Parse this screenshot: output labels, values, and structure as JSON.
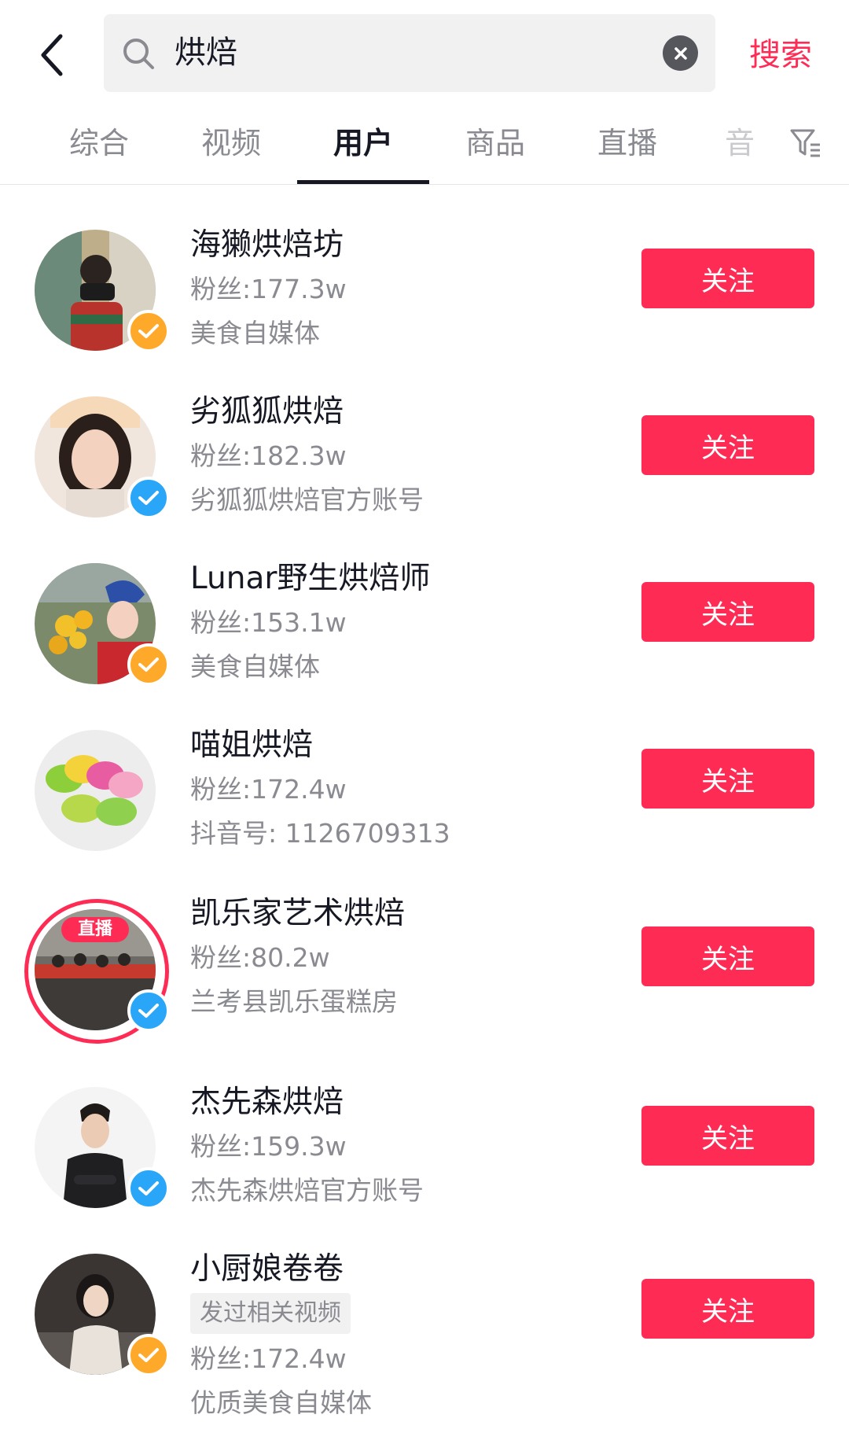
{
  "search": {
    "query": "烘焙",
    "submit_label": "搜索"
  },
  "tabs": [
    {
      "label": "综合",
      "active": false
    },
    {
      "label": "视频",
      "active": false
    },
    {
      "label": "用户",
      "active": true
    },
    {
      "label": "商品",
      "active": false
    },
    {
      "label": "直播",
      "active": false
    },
    {
      "label": "音",
      "active": false
    }
  ],
  "users": [
    {
      "name": "海獭烘焙坊",
      "fans": "粉丝:177.3w",
      "desc": "美食自媒体",
      "verified": "orange",
      "follow": "关注"
    },
    {
      "name": "劣狐狐烘焙",
      "fans": "粉丝:182.3w",
      "desc": "劣狐狐烘焙官方账号",
      "verified": "blue",
      "follow": "关注"
    },
    {
      "name": "Lunar野生烘焙师",
      "fans": "粉丝:153.1w",
      "desc": "美食自媒体",
      "verified": "orange",
      "follow": "关注"
    },
    {
      "name": "喵姐烘焙",
      "fans": "粉丝:172.4w",
      "desc": "抖音号: 1126709313",
      "verified": "none",
      "follow": "关注"
    },
    {
      "name": "凯乐家艺术烘焙",
      "fans": "粉丝:80.2w",
      "desc": "兰考县凯乐蛋糕房",
      "verified": "blue",
      "live": "直播",
      "follow": "关注"
    },
    {
      "name": "杰先森烘焙",
      "fans": "粉丝:159.3w",
      "desc": "杰先森烘焙官方账号",
      "verified": "blue",
      "follow": "关注"
    },
    {
      "name": "小厨娘卷卷",
      "tag": "发过相关视频",
      "fans": "粉丝:172.4w",
      "desc": "优质美食自媒体",
      "verified": "orange",
      "follow": "关注"
    }
  ],
  "colors": {
    "accent": "#fe2c55",
    "verified_orange": "#ffa92a",
    "verified_blue": "#2aa6f8",
    "text_primary": "#161823",
    "text_secondary": "#8a8b91"
  },
  "icons": {
    "back": "chevron-left-icon",
    "search": "search-icon",
    "clear": "close-icon",
    "filter": "filter-icon",
    "verified": "checkmark-icon"
  }
}
